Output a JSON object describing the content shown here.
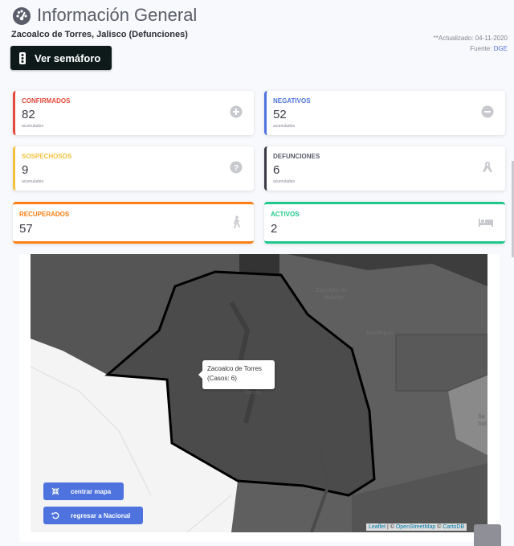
{
  "header": {
    "title": "Información General",
    "subtitle": "Zacoalco de Torres, Jalisco (Defunciones)",
    "updated": "**Actualizado: 04-11-2020",
    "source_prefix": "Fuente: ",
    "source_link": "DGE",
    "semaforo_button": "Ver semáforo"
  },
  "cards": [
    {
      "label": "CONFIRMADOS",
      "value": "82",
      "note": "acumulados",
      "color": "#e74a3b",
      "icon": "plus-circle-icon"
    },
    {
      "label": "NEGATIVOS",
      "value": "52",
      "note": "acumulados",
      "color": "#4e73df",
      "icon": "minus-circle-icon"
    },
    {
      "label": "SOSPECHOSOS",
      "value": "9",
      "note": "acumulados",
      "color": "#f6c23e",
      "icon": "question-circle-icon"
    },
    {
      "label": "DEFUNCIONES",
      "value": "6",
      "note": "acumuladas",
      "color": "#3a3b45",
      "icon": "ribbon-icon"
    },
    {
      "label": "RECUPERADOS",
      "value": "57",
      "note": "",
      "color": "#fd7e14",
      "icon": "walking-icon"
    },
    {
      "label": "ACTIVOS",
      "value": "2",
      "note": "",
      "color": "#1cc88a",
      "icon": "bed-icon"
    }
  ],
  "map": {
    "tooltip_line1": "Zacoalco de Torres",
    "tooltip_line2": "(Casos: 6)",
    "labels": [
      "Zapotlán de",
      "Hidalgo",
      "Jocotepec",
      "Torres",
      "Sa",
      "Sol"
    ],
    "center_button": "centrar mapa",
    "back_button": "regresar a Nacional",
    "attribution_leaflet": "Leaflet",
    "attribution_sep": " | © ",
    "attribution_osm": "OpenStreetMap",
    "attribution_sep2": " © ",
    "attribution_carto": "CartoDB"
  }
}
